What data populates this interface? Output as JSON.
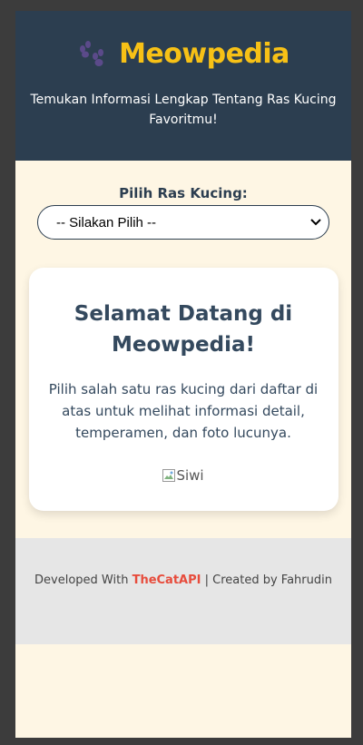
{
  "header": {
    "title": "Meowpedia",
    "subtitle": "Temukan Informasi Lengkap Tentang Ras Kucing Favoritmu!",
    "title_color": "#f7c116",
    "background": "#2c3e50"
  },
  "selector": {
    "label": "Pilih Ras Kucing:",
    "selected": "-- Silakan Pilih --"
  },
  "card": {
    "heading": "Selamat Datang di Meowpedia!",
    "text": "Pilih salah satu ras kucing dari daftar di atas untuk melihat informasi detail, temperamen, dan foto lucunya.",
    "image_alt": "Siwi"
  },
  "footer": {
    "prefix": "Developed With ",
    "api_link": "TheCatAPI",
    "suffix": " | Created by Fahrudin",
    "link_color": "#e74c3c"
  },
  "page_background": "#fef6e4"
}
